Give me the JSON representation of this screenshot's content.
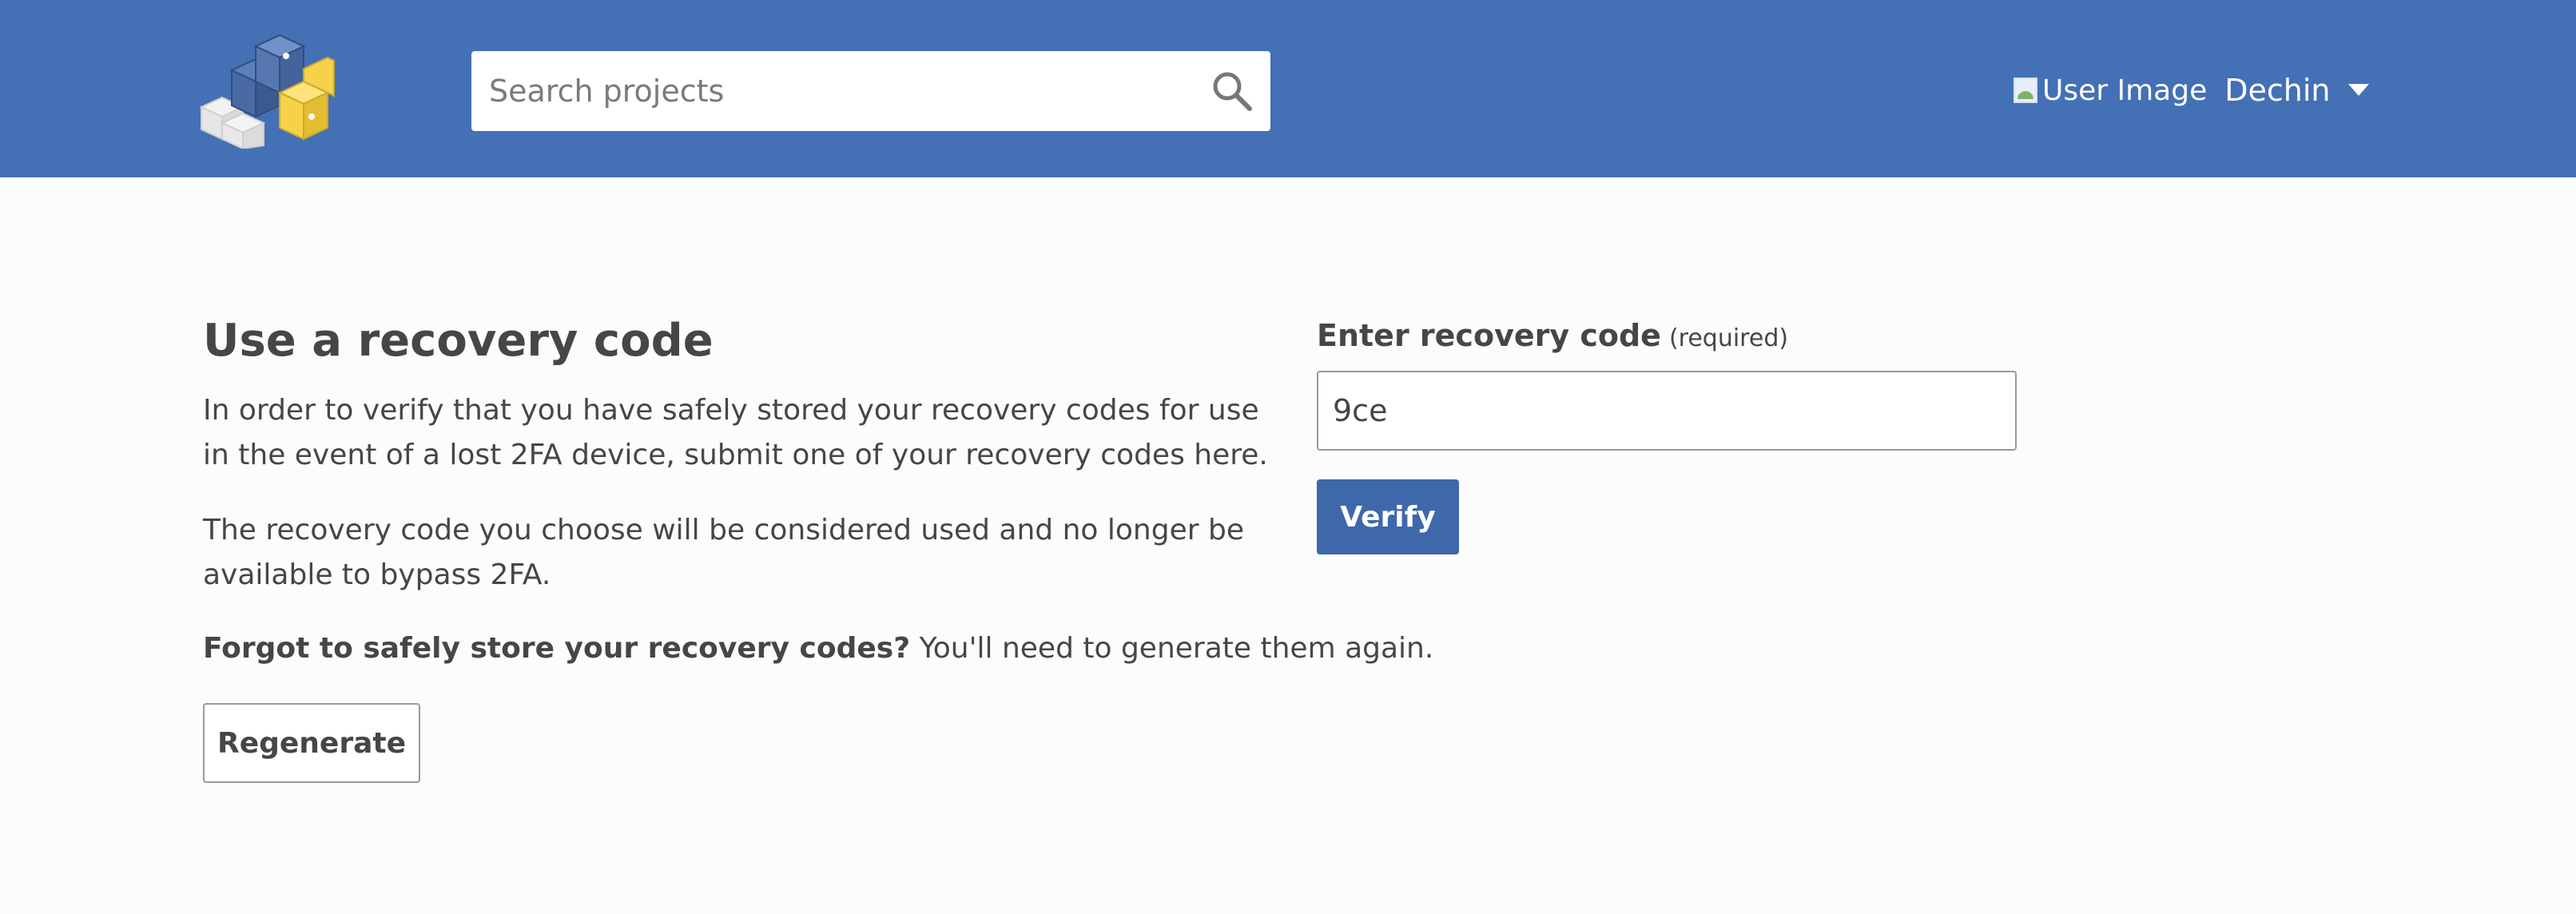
{
  "header": {
    "logo_name": "pypi-logo",
    "search": {
      "placeholder": "Search projects",
      "value": ""
    },
    "user": {
      "image_alt": "User Image",
      "name": "Dechin"
    }
  },
  "main": {
    "title": "Use a recovery code",
    "paragraph1": "In order to verify that you have safely stored your recovery codes for use in the event of a lost 2FA device, submit one of your recovery codes here.",
    "paragraph2": "The recovery code you choose will be considered used and no longer be available to bypass 2FA.",
    "forgot_bold": "Forgot to safely store your recovery codes?",
    "forgot_rest": " You'll need to generate them again.",
    "regenerate_label": "Regenerate"
  },
  "form": {
    "label": "Enter recovery code",
    "required": "(required)",
    "value": "9ce",
    "verify_label": "Verify"
  },
  "colors": {
    "header_bg": "#4470b5",
    "button_primary": "#3e68aa",
    "page_bg": "#fcfcfc",
    "text": "#464646"
  }
}
